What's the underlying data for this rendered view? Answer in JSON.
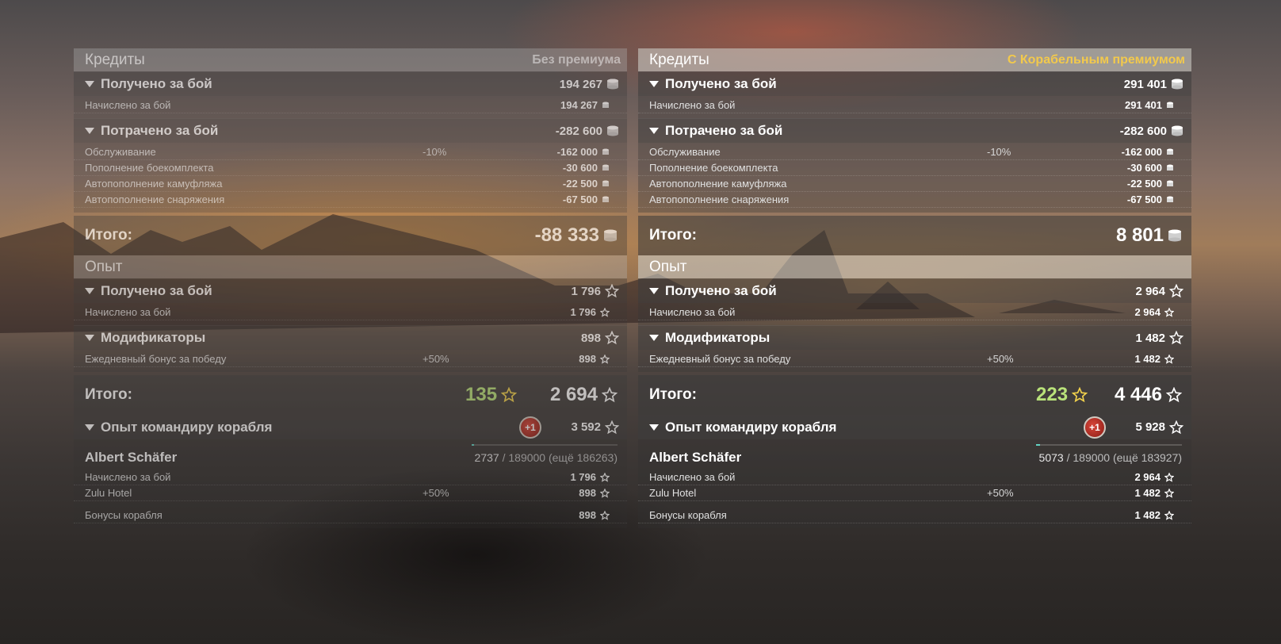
{
  "left": {
    "header": {
      "title": "Кредиты",
      "subtitle": "Без премиума"
    },
    "credits_earned": {
      "title": "Получено за бой",
      "value": "194 267",
      "items": [
        {
          "name": "Начислено за бой",
          "pct": "",
          "value": "194 267"
        }
      ]
    },
    "credits_spent": {
      "title": "Потрачено за бой",
      "value": "-282 600",
      "items": [
        {
          "name": "Обслуживание",
          "pct": "-10%",
          "value": "-162 000"
        },
        {
          "name": "Пополнение боекомплекта",
          "pct": "",
          "value": "-30 600"
        },
        {
          "name": "Автопополнение камуфляжа",
          "pct": "",
          "value": "-22 500"
        },
        {
          "name": "Автопополнение снаряжения",
          "pct": "",
          "value": "-67 500"
        }
      ]
    },
    "credits_total": {
      "label": "Итого:",
      "value": "-88 333"
    },
    "xp_header": {
      "title": "Опыт"
    },
    "xp_earned": {
      "title": "Получено за бой",
      "value": "1 796",
      "items": [
        {
          "name": "Начислено за бой",
          "pct": "",
          "value": "1 796"
        }
      ]
    },
    "modifiers": {
      "title": "Модификаторы",
      "value": "898",
      "items": [
        {
          "name": "Ежедневный бонус за победу",
          "pct": "+50%",
          "value": "898"
        }
      ]
    },
    "xp_total": {
      "label": "Итого:",
      "free_xp": "135",
      "value": "2 694"
    },
    "commander": {
      "title": "Опыт командиру корабля",
      "badge": "+1",
      "value": "3 592",
      "name": "Albert Schäfer",
      "progress_current": "2737",
      "progress_rest": " / 189000 (ещё 186263)",
      "progress_fraction": 0.0145,
      "items": [
        {
          "name": "Начислено за бой",
          "pct": "",
          "value": "1 796"
        },
        {
          "name": "Zulu Hotel",
          "pct": "+50%",
          "value": "898"
        }
      ],
      "ship_bonus": {
        "name": "Бонусы корабля",
        "value": "898"
      }
    }
  },
  "right": {
    "header": {
      "title": "Кредиты",
      "subtitle": "С Корабельным премиумом"
    },
    "credits_earned": {
      "title": "Получено за бой",
      "value": "291 401",
      "items": [
        {
          "name": "Начислено за бой",
          "pct": "",
          "value": "291 401"
        }
      ]
    },
    "credits_spent": {
      "title": "Потрачено за бой",
      "value": "-282 600",
      "items": [
        {
          "name": "Обслуживание",
          "pct": "-10%",
          "value": "-162 000"
        },
        {
          "name": "Пополнение боекомплекта",
          "pct": "",
          "value": "-30 600"
        },
        {
          "name": "Автопополнение камуфляжа",
          "pct": "",
          "value": "-22 500"
        },
        {
          "name": "Автопополнение снаряжения",
          "pct": "",
          "value": "-67 500"
        }
      ]
    },
    "credits_total": {
      "label": "Итого:",
      "value": "8 801"
    },
    "xp_header": {
      "title": "Опыт"
    },
    "xp_earned": {
      "title": "Получено за бой",
      "value": "2 964",
      "items": [
        {
          "name": "Начислено за бой",
          "pct": "",
          "value": "2 964"
        }
      ]
    },
    "modifiers": {
      "title": "Модификаторы",
      "value": "1 482",
      "items": [
        {
          "name": "Ежедневный бонус за победу",
          "pct": "+50%",
          "value": "1 482"
        }
      ]
    },
    "xp_total": {
      "label": "Итого:",
      "free_xp": "223",
      "value": "4 446"
    },
    "commander": {
      "title": "Опыт командиру корабля",
      "badge": "+1",
      "value": "5 928",
      "name": "Albert Schäfer",
      "progress_current": "5073",
      "progress_rest": " / 189000 (ещё 183927)",
      "progress_fraction": 0.0268,
      "items": [
        {
          "name": "Начислено за бой",
          "pct": "",
          "value": "2 964"
        },
        {
          "name": "Zulu Hotel",
          "pct": "+50%",
          "value": "1 482"
        }
      ],
      "ship_bonus": {
        "name": "Бонусы корабля",
        "value": "1 482"
      }
    }
  },
  "icons": {
    "credit": "coin-stack-icon",
    "xp": "star-icon",
    "collapse": "triangle-down-icon"
  },
  "colors": {
    "premium_label": "#f2c94c",
    "free_xp": "#b9e27a",
    "progress_fill": "#64d4c4",
    "badge": "#c0392b"
  }
}
